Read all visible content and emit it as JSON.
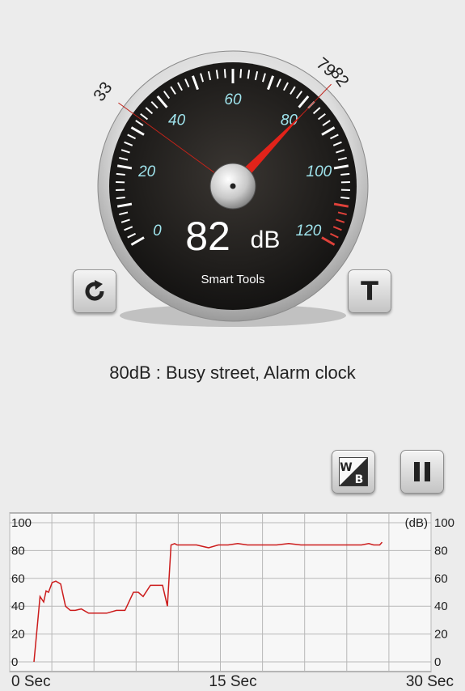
{
  "meter": {
    "value": 82,
    "unit": "dB",
    "min_marker": 33,
    "max_marker_79": 79,
    "max_marker_82": 82,
    "brand": "Smart Tools",
    "scale_labels": [
      "0",
      "20",
      "40",
      "60",
      "80",
      "100",
      "120"
    ],
    "colors": {
      "needle": "#e2231a",
      "face": "#1c1a18",
      "scale_label": "#9fe3ec",
      "marker_line": "#c0231a"
    }
  },
  "buttons": {
    "reset_icon": "refresh-icon",
    "theme_label": "T",
    "wb_label_w": "W",
    "wb_label_b": "B",
    "pause_icon": "pause-icon"
  },
  "reference": {
    "text": "80dB : Busy street, Alarm clock"
  },
  "graph": {
    "y_ticks": [
      "0",
      "20",
      "40",
      "60",
      "80",
      "100"
    ],
    "unit_label": "(dB)",
    "x_labels": [
      "0 Sec",
      "15 Sec",
      "30 Sec"
    ],
    "line_color": "#cc1c1c",
    "chart_data": {
      "type": "line",
      "x": [
        0,
        0.3,
        0.5,
        0.8,
        1.0,
        1.2,
        1.5,
        1.8,
        2.2,
        2.6,
        3.0,
        3.4,
        3.9,
        4.5,
        5.4,
        6.0,
        6.8,
        7.5,
        8.2,
        8.6,
        9.0,
        9.6,
        10.0,
        10.6,
        11.0,
        11.3,
        11.6,
        11.8,
        12.0,
        12.2,
        12.6,
        13.4,
        14.4,
        15.2,
        16.0,
        16.8,
        17.6,
        18.4,
        19.2,
        20.0,
        21.0,
        22.0,
        23.0,
        24.0,
        25.0,
        26.0,
        27.0,
        27.6,
        28.0,
        28.5,
        28.7
      ],
      "y": [
        0,
        28,
        47,
        43,
        51,
        50,
        57,
        58,
        56,
        40,
        37,
        37,
        38,
        35,
        35,
        35,
        37,
        37,
        50,
        50,
        47,
        55,
        55,
        55,
        40,
        84,
        85,
        84,
        84,
        84,
        84,
        84,
        82,
        84,
        84,
        85,
        84,
        84,
        84,
        84,
        85,
        84,
        84,
        84,
        84,
        84,
        84,
        85,
        84,
        84,
        86
      ],
      "xlabel": "",
      "ylabel": "(dB)",
      "ylim": [
        0,
        100
      ],
      "xlim": [
        0,
        30
      ],
      "grid": true
    }
  }
}
